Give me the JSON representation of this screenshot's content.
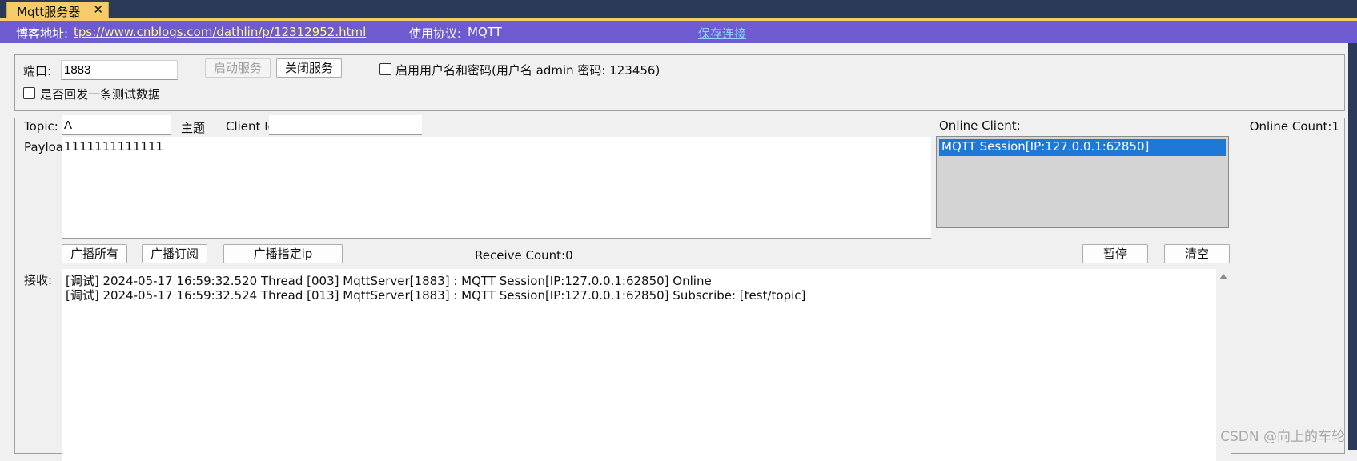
{
  "tab": {
    "title": "Mqtt服务器",
    "close": "✕"
  },
  "infobar": {
    "blog_label": "博客地址:",
    "blog_url": "tps://www.cnblogs.com/dathlin/p/12312952.html",
    "protocol_label": "使用协议:",
    "protocol_value": "MQTT",
    "save_link": "保存连接"
  },
  "config": {
    "port_label": "端口:",
    "port_value": "1883",
    "start_button": "启动服务",
    "stop_button": "关闭服务",
    "auth_checkbox_label": "启用用户名和密码(用户名 admin  密码: 123456)",
    "reply_checkbox_label": "是否回发一条测试数据"
  },
  "publish": {
    "topic_label": "Topic:",
    "topic_value": "A",
    "topic_hint": "主题",
    "clientid_label": "Client Ic",
    "clientid_value": "",
    "payload_label": "Payload",
    "payload_value": "1111111111111",
    "broadcast_all": "广播所有",
    "broadcast_subscribe": "广播订阅",
    "broadcast_ip": "广播指定ip",
    "receive_count": "Receive Count:0",
    "pause_button": "暂停",
    "clear_button": "清空"
  },
  "clients": {
    "title": "Online Client:",
    "count": "Online Count:1",
    "items": [
      "MQTT Session[IP:127.0.0.1:62850]"
    ]
  },
  "log": {
    "label": "接收:",
    "lines": [
      "[调试] 2024-05-17 16:59:32.520 Thread [003] MqttServer[1883] : MQTT Session[IP:127.0.0.1:62850] Online",
      "[调试] 2024-05-17 16:59:32.524 Thread [013] MqttServer[1883] : MQTT Session[IP:127.0.0.1:62850] Subscribe: [test/topic]"
    ]
  },
  "watermark": "CSDN @向上的车轮",
  "colors": {
    "tab_bg": "#f5cc68",
    "infobar_bg": "#6f5bd1",
    "selection": "#1e78d6"
  }
}
